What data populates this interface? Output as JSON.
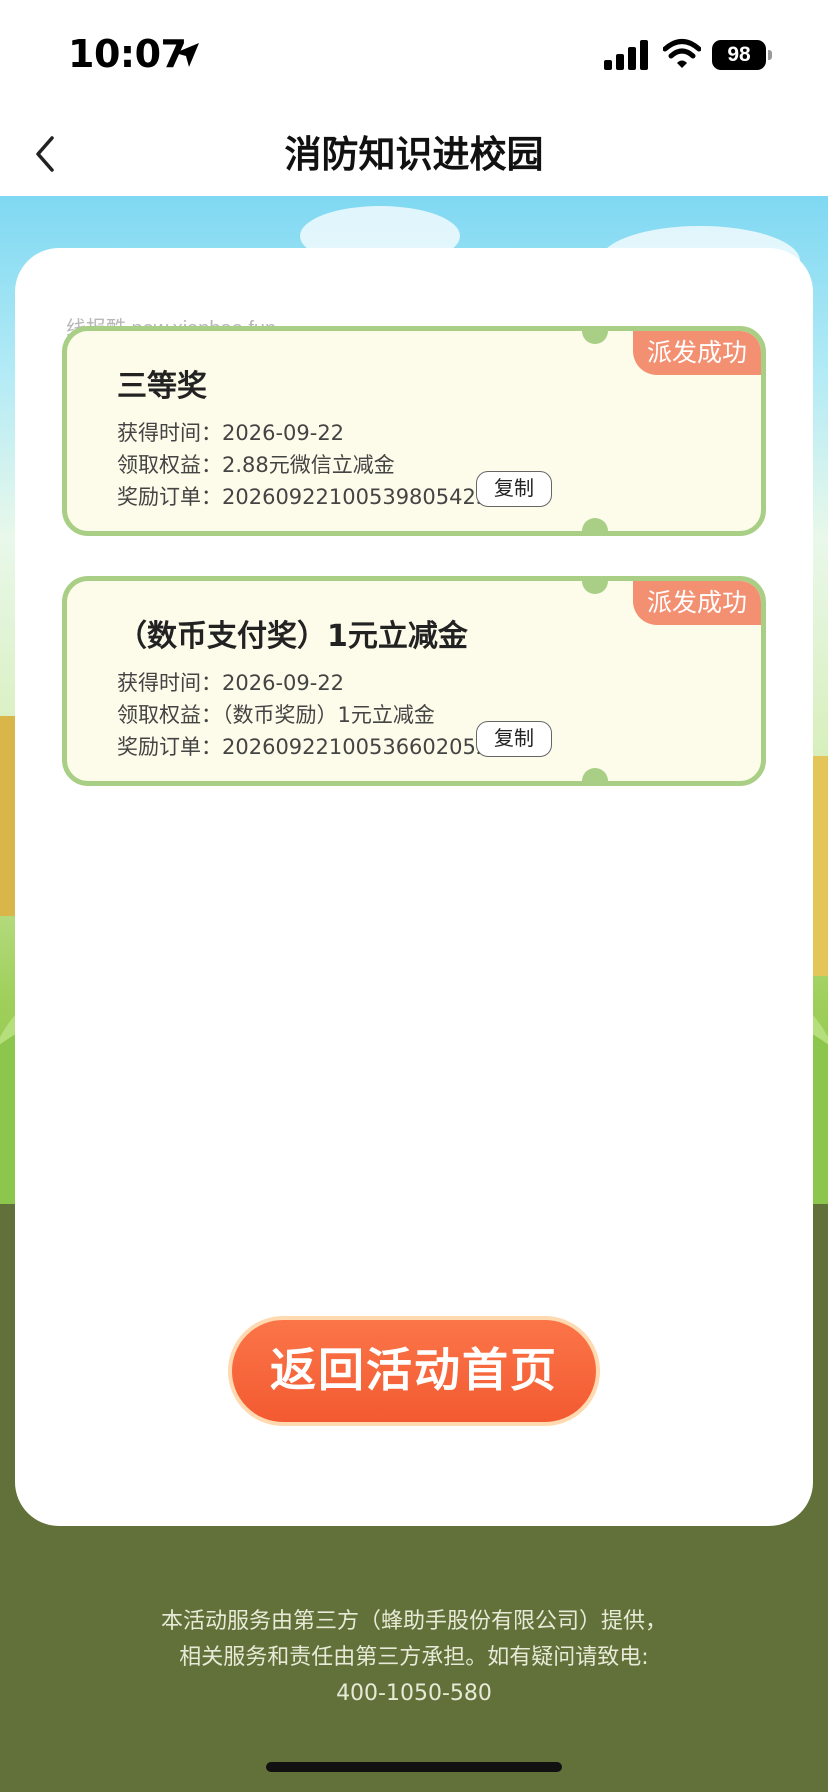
{
  "status_bar": {
    "time": "10:07",
    "battery": "98"
  },
  "nav": {
    "title": "消防知识进校园"
  },
  "watermark": "线报酷 new.xianbao.fun",
  "rewards": [
    {
      "title": "三等奖",
      "status": "派发成功",
      "time_label": "获得时间：",
      "time_value": "2026-09-22",
      "benefit_label": "领取权益：",
      "benefit_value": "2.88元微信立减金",
      "order_label": "奖励订单：",
      "order_value": "20260922100539805423",
      "copy_label": "复制"
    },
    {
      "title": "（数币支付奖）1元立减金",
      "status": "派发成功",
      "time_label": "获得时间：",
      "time_value": "2026-09-22",
      "benefit_label": "领取权益：",
      "benefit_value": "（数币奖励）1元立减金",
      "order_label": "奖励订单：",
      "order_value": "20260922100536602052",
      "copy_label": "复制"
    }
  ],
  "return_button": "返回活动首页",
  "footer": {
    "line1": "本活动服务由第三方（蜂助手股份有限公司）提供，",
    "line2": "相关服务和责任由第三方承担。如有疑问请致电:",
    "phone": "400-1050-580"
  },
  "colors": {
    "accent": "#f35a32",
    "card_border": "#a9cf86",
    "card_bg": "#fdfcea",
    "tag": "#f49072",
    "footer_bg": "#62703a"
  }
}
